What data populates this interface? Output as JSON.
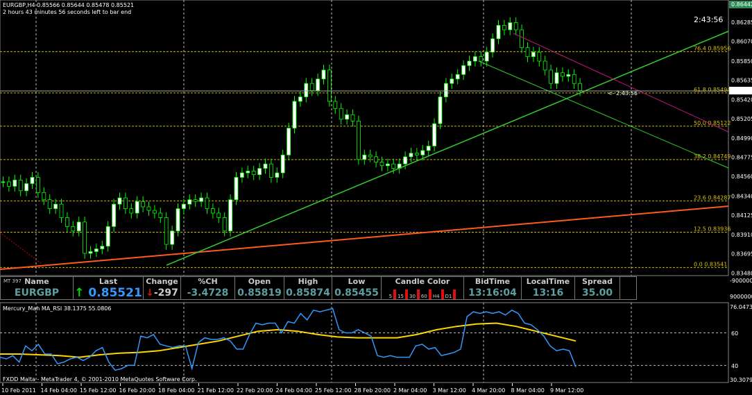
{
  "header": {
    "symbol_line": "EURGBP,H4  0.85566 0.85644 0.85478 0.85521",
    "countdown_text": "2 hours 43 minutes 56 seconds left to bar end",
    "timer": "2:43:56",
    "price_marker": "<- 2:43:56"
  },
  "ticker": {
    "id": "MT 397",
    "headers": [
      "Name",
      "Last",
      "Change",
      "%CH",
      "Open",
      "High",
      "Low",
      "Candle Color",
      "BidTime",
      "LocalTime",
      "Spread"
    ],
    "name": "EURGBP",
    "last": "0.85521",
    "change": "-297",
    "pch": "-3.4728",
    "open": "0.85819",
    "high": "0.85874",
    "low": "0.85455",
    "candle_tfs": [
      "5",
      "15",
      "30",
      "60",
      "H4",
      "D1"
    ],
    "bidtime": "13:16:04",
    "localtime": "13:16",
    "spread": "35.00",
    "up_arrow": "↑",
    "down_arrow": "↓"
  },
  "indicator": {
    "label": "Mercury_Mah MA_RSI 38.1375 55.0806",
    "max_label": "76.0473",
    "min_label": "30.3079",
    "ticks": [
      "60",
      "40"
    ]
  },
  "copyright": "FXDD Malta - MetaTrader 4, © 2001-2010 MetaQuotes Software Corp.",
  "separator_axis": [
    "-9000000",
    "9000000"
  ],
  "chart_data": {
    "type": "candlestick",
    "title": "EURGBP,H4",
    "colors": {
      "bull": "#ffffff",
      "bear": "#000000",
      "wick": "#00ff00",
      "rsi": "#3399ff",
      "ma": "#ffd700"
    },
    "ylim": [
      0.8348,
      0.86442
    ],
    "y_ticks": [
      "0.86442",
      "0.86285",
      "0.86070",
      "0.85850",
      "0.85635",
      "0.85521",
      "0.85420",
      "0.85205",
      "0.84990",
      "0.84775",
      "0.84560",
      "0.84340",
      "0.84125",
      "0.83910",
      "0.83695",
      "0.83480"
    ],
    "current_price": "0.85521",
    "x_ticks": [
      "10 Feb 2011",
      "14 Feb 04:00",
      "15 Feb 12:00",
      "16 Feb 20:00",
      "18 Feb 04:00",
      "21 Feb 12:00",
      "22 Feb 20:00",
      "24 Feb 04:00",
      "25 Feb 12:00",
      "28 Feb 20:00",
      "2 Mar 04:00",
      "3 Mar 12:00",
      "4 Mar 20:00",
      "8 Mar 04:00",
      "9 Mar 12:00"
    ],
    "closes": [
      0.845,
      0.8445,
      0.8452,
      0.844,
      0.8448,
      0.8455,
      0.8438,
      0.843,
      0.842,
      0.8425,
      0.841,
      0.84,
      0.8395,
      0.8405,
      0.837,
      0.8372,
      0.8375,
      0.8378,
      0.84,
      0.8425,
      0.8432,
      0.842,
      0.8415,
      0.8428,
      0.8422,
      0.8418,
      0.8415,
      0.841,
      0.838,
      0.8395,
      0.842,
      0.8425,
      0.843,
      0.8428,
      0.8432,
      0.842,
      0.8415,
      0.841,
      0.8395,
      0.843,
      0.8455,
      0.846,
      0.8462,
      0.8458,
      0.8465,
      0.847,
      0.8455,
      0.846,
      0.848,
      0.851,
      0.854,
      0.8545,
      0.856,
      0.8552,
      0.8565,
      0.8575,
      0.854,
      0.8532,
      0.852,
      0.8525,
      0.8518,
      0.8475,
      0.848,
      0.8478,
      0.8472,
      0.8468,
      0.847,
      0.8465,
      0.847,
      0.8478,
      0.8482,
      0.848,
      0.8485,
      0.849,
      0.8515,
      0.8545,
      0.856,
      0.8565,
      0.857,
      0.858,
      0.8585,
      0.859,
      0.8585,
      0.8595,
      0.861,
      0.8625,
      0.862,
      0.8628,
      0.862,
      0.86,
      0.859,
      0.8595,
      0.8585,
      0.8575,
      0.856,
      0.8572,
      0.8568,
      0.857,
      0.856,
      0.8552
    ],
    "fib_levels": [
      {
        "label": "76.4 0.85956",
        "price": 0.85956
      },
      {
        "label": "61.8 0.85494",
        "price": 0.85494
      },
      {
        "label": "50.0 0.85122",
        "price": 0.85122
      },
      {
        "label": "38.2 0.84749",
        "price": 0.84749
      },
      {
        "label": "23.6 0.84287",
        "price": 0.84287
      },
      {
        "label": "12.5 0.83936",
        "price": 0.83936
      },
      {
        "label": "0.0 0.83541",
        "price": 0.83541
      }
    ],
    "rsi_ylim": [
      30.3079,
      76.0473
    ],
    "rsi": [
      45,
      44,
      46,
      42,
      52,
      49,
      53,
      47,
      47,
      41,
      42,
      44,
      45,
      43,
      45,
      49,
      51,
      42,
      37,
      38,
      40,
      40,
      58,
      57,
      59,
      53,
      52,
      51,
      52,
      52,
      38,
      54,
      57,
      56,
      56,
      57,
      55,
      50,
      50,
      59,
      66,
      65,
      66,
      66,
      60,
      67,
      66,
      72,
      68,
      74,
      73,
      74,
      75,
      62,
      60,
      60,
      62,
      60,
      58,
      46,
      45,
      46,
      45,
      45,
      45,
      52,
      53,
      50,
      51,
      46,
      47,
      48,
      50,
      70,
      73,
      72,
      73,
      72,
      73,
      71,
      74,
      72,
      66,
      65,
      62,
      58,
      52,
      49,
      50,
      49,
      39
    ],
    "rsi_ma": [
      47,
      47,
      46.5,
      46,
      45,
      46.5,
      47.5,
      48,
      49,
      51,
      53,
      55,
      58,
      61,
      62,
      61,
      59,
      57.5,
      57,
      57,
      57,
      59,
      62,
      64,
      65.5,
      66,
      64,
      61,
      58,
      55
    ]
  }
}
